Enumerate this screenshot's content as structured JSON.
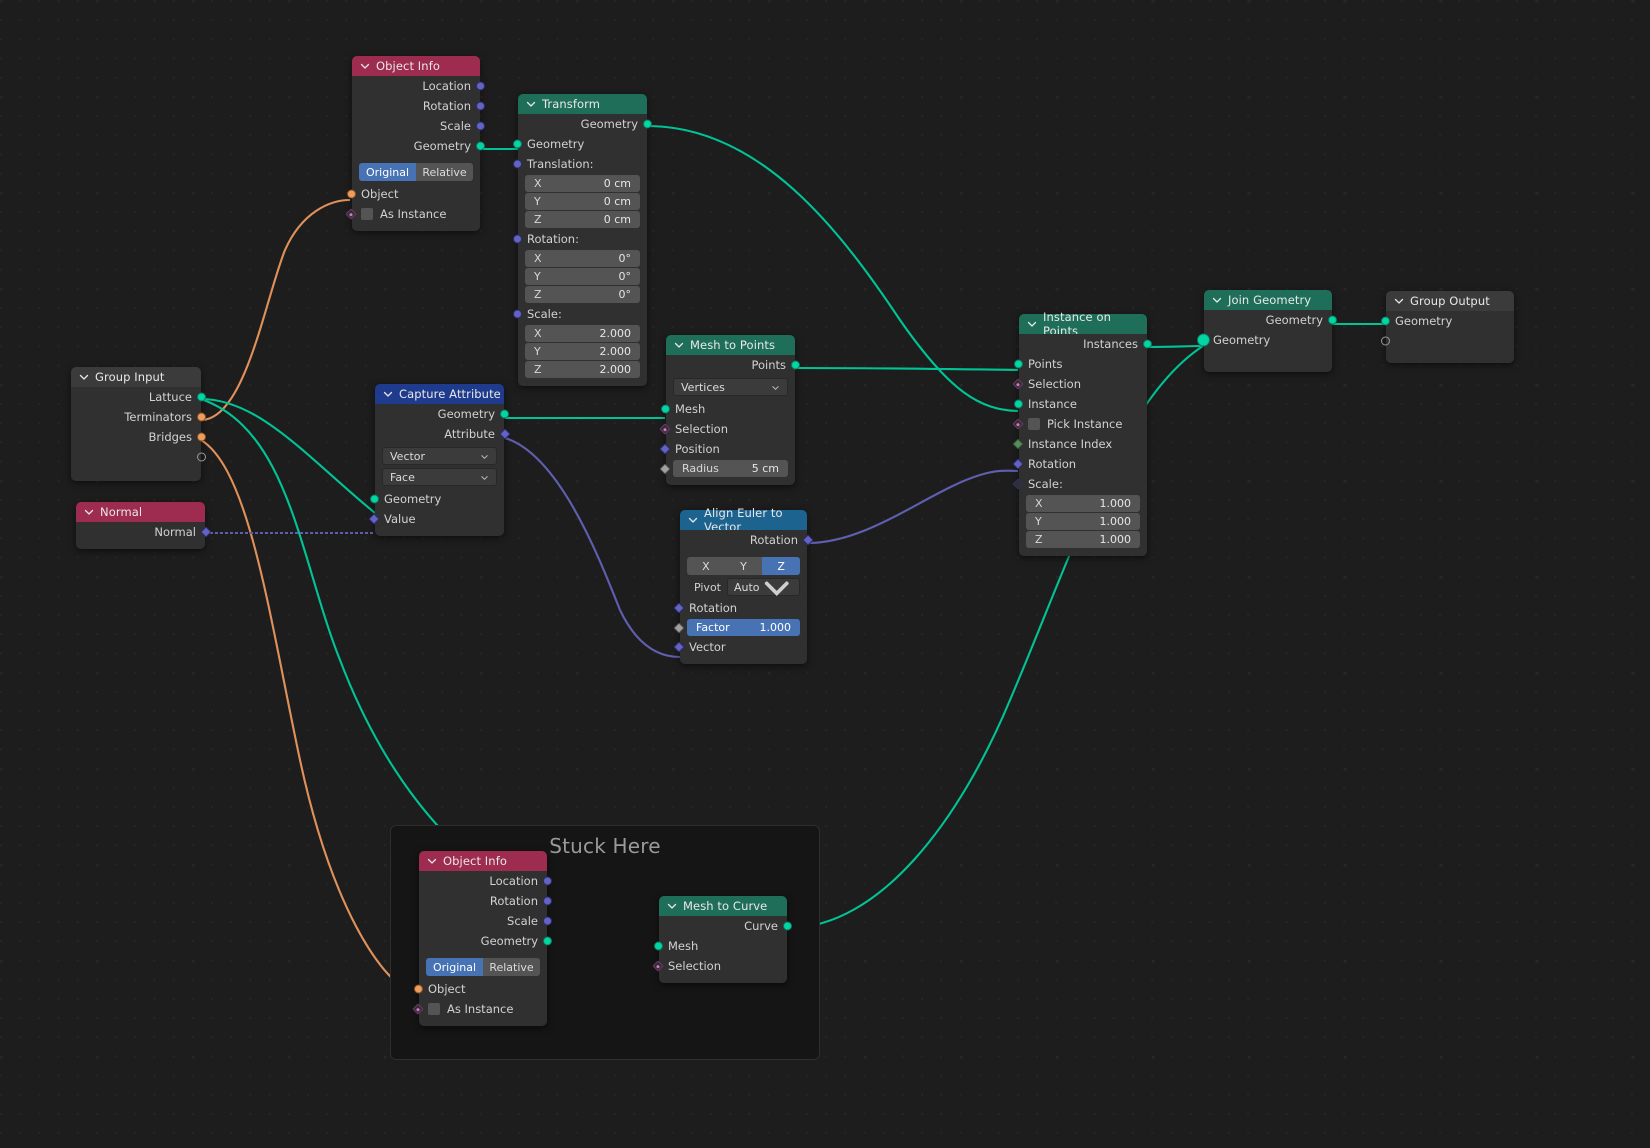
{
  "frame": {
    "label": "Stuck Here"
  },
  "colors": {
    "geometry_socket": "#00d6a3",
    "vector_socket": "#6363c7",
    "boolean_socket": "#cf7ac7",
    "object_socket": "#ed9e5c",
    "integer_socket": "#598c5c",
    "accent_blue": "#4772b3",
    "header_geometry": "#1f6e5a",
    "header_input": "#3b3b3b",
    "header_red": "#9e2b50",
    "header_blue": "#1f3b8e",
    "header_vector": "#1c638f",
    "background": "#1d1d1d"
  },
  "nodes": {
    "object_info_top": {
      "title": "Object Info",
      "outputs": [
        "Location",
        "Rotation",
        "Scale",
        "Geometry"
      ],
      "transform_space": {
        "options": [
          "Original",
          "Relative"
        ],
        "selected": "Original"
      },
      "inputs": [
        "Object",
        "As Instance"
      ]
    },
    "transform": {
      "title": "Transform",
      "outputs": [
        "Geometry"
      ],
      "inputs": [
        "Geometry",
        "Translation:",
        "Rotation:",
        "Scale:"
      ],
      "translation": {
        "x_label": "X",
        "x_value": "0 cm",
        "y_label": "Y",
        "y_value": "0 cm",
        "z_label": "Z",
        "z_value": "0 cm"
      },
      "rotation": {
        "x_label": "X",
        "x_value": "0°",
        "y_label": "Y",
        "y_value": "0°",
        "z_label": "Z",
        "z_value": "0°"
      },
      "scale": {
        "x_label": "X",
        "x_value": "2.000",
        "y_label": "Y",
        "y_value": "2.000",
        "z_label": "Z",
        "z_value": "2.000"
      }
    },
    "group_input": {
      "title": "Group Input",
      "outputs": [
        "Lattuce",
        "Terminators",
        "Bridges"
      ]
    },
    "normal": {
      "title": "Normal",
      "outputs": [
        "Normal"
      ]
    },
    "capture_attribute": {
      "title": "Capture Attribute",
      "outputs": [
        "Geometry",
        "Attribute"
      ],
      "data_type": "Vector",
      "domain": "Face",
      "inputs": [
        "Geometry",
        "Value"
      ]
    },
    "mesh_to_points": {
      "title": "Mesh to Points",
      "outputs": [
        "Points"
      ],
      "mode": "Vertices",
      "inputs": [
        "Mesh",
        "Selection",
        "Position"
      ],
      "radius": {
        "label": "Radius",
        "value": "5 cm"
      }
    },
    "align_euler_to_vector": {
      "title": "Align Euler to Vector",
      "outputs": [
        "Rotation"
      ],
      "axis": {
        "options": [
          "X",
          "Y",
          "Z"
        ],
        "selected": "Z"
      },
      "pivot": {
        "label": "Pivot",
        "value": "Auto"
      },
      "inputs": [
        "Rotation",
        "Vector"
      ],
      "factor": {
        "label": "Factor",
        "value": "1.000"
      }
    },
    "instance_on_points": {
      "title": "Instance on Points",
      "outputs": [
        "Instances"
      ],
      "inputs": [
        "Points",
        "Selection",
        "Instance",
        "Pick Instance",
        "Instance Index",
        "Rotation",
        "Scale:"
      ],
      "scale": {
        "x_label": "X",
        "x_value": "1.000",
        "y_label": "Y",
        "y_value": "1.000",
        "z_label": "Z",
        "z_value": "1.000"
      }
    },
    "join_geometry": {
      "title": "Join Geometry",
      "outputs": [
        "Geometry"
      ],
      "inputs": [
        "Geometry"
      ]
    },
    "group_output": {
      "title": "Group Output",
      "inputs": [
        "Geometry"
      ]
    },
    "object_info_bottom": {
      "title": "Object Info",
      "outputs": [
        "Location",
        "Rotation",
        "Scale",
        "Geometry"
      ],
      "transform_space": {
        "options": [
          "Original",
          "Relative"
        ],
        "selected": "Original"
      },
      "inputs": [
        "Object",
        "As Instance"
      ]
    },
    "mesh_to_curve": {
      "title": "Mesh to Curve",
      "outputs": [
        "Curve"
      ],
      "inputs": [
        "Mesh",
        "Selection"
      ]
    }
  }
}
